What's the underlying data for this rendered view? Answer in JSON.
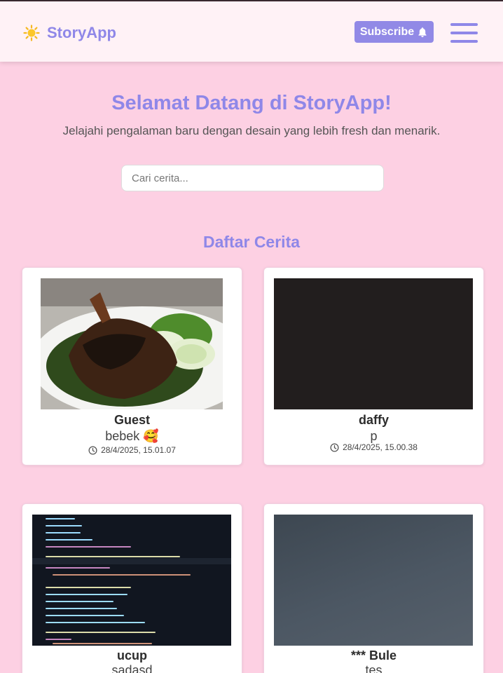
{
  "header": {
    "brand": "StoryApp",
    "subscribe_label": "Subscribe",
    "icons": {
      "brand": "sun-icon",
      "subscribe": "bell-icon",
      "menu": "hamburger-menu-icon"
    }
  },
  "hero": {
    "title": "Selamat Datang di StoryApp!",
    "subtitle": "Jelajahi pengalaman baru dengan desain yang lebih fresh dan menarik."
  },
  "search": {
    "placeholder": "Cari cerita...",
    "value": ""
  },
  "stories": {
    "title": "Daftar Cerita",
    "items": [
      {
        "name": "Guest",
        "description": "bebek 🥰",
        "date": "28/4/2025, 15.01.07",
        "image": "fried-duck-photo"
      },
      {
        "name": "daffy",
        "description": "p",
        "date": "28/4/2025, 15.00.38",
        "image": "dark-photo"
      },
      {
        "name": "ucup",
        "description": "sadasd",
        "date": "",
        "image": "code-screenshot"
      },
      {
        "name": "*** Bule",
        "description": "tes",
        "date": "",
        "image": "blue-gray-photo"
      }
    ]
  },
  "colors": {
    "accent": "#8f87e8",
    "background": "#fdd0e3",
    "header": "#fff2f6"
  }
}
